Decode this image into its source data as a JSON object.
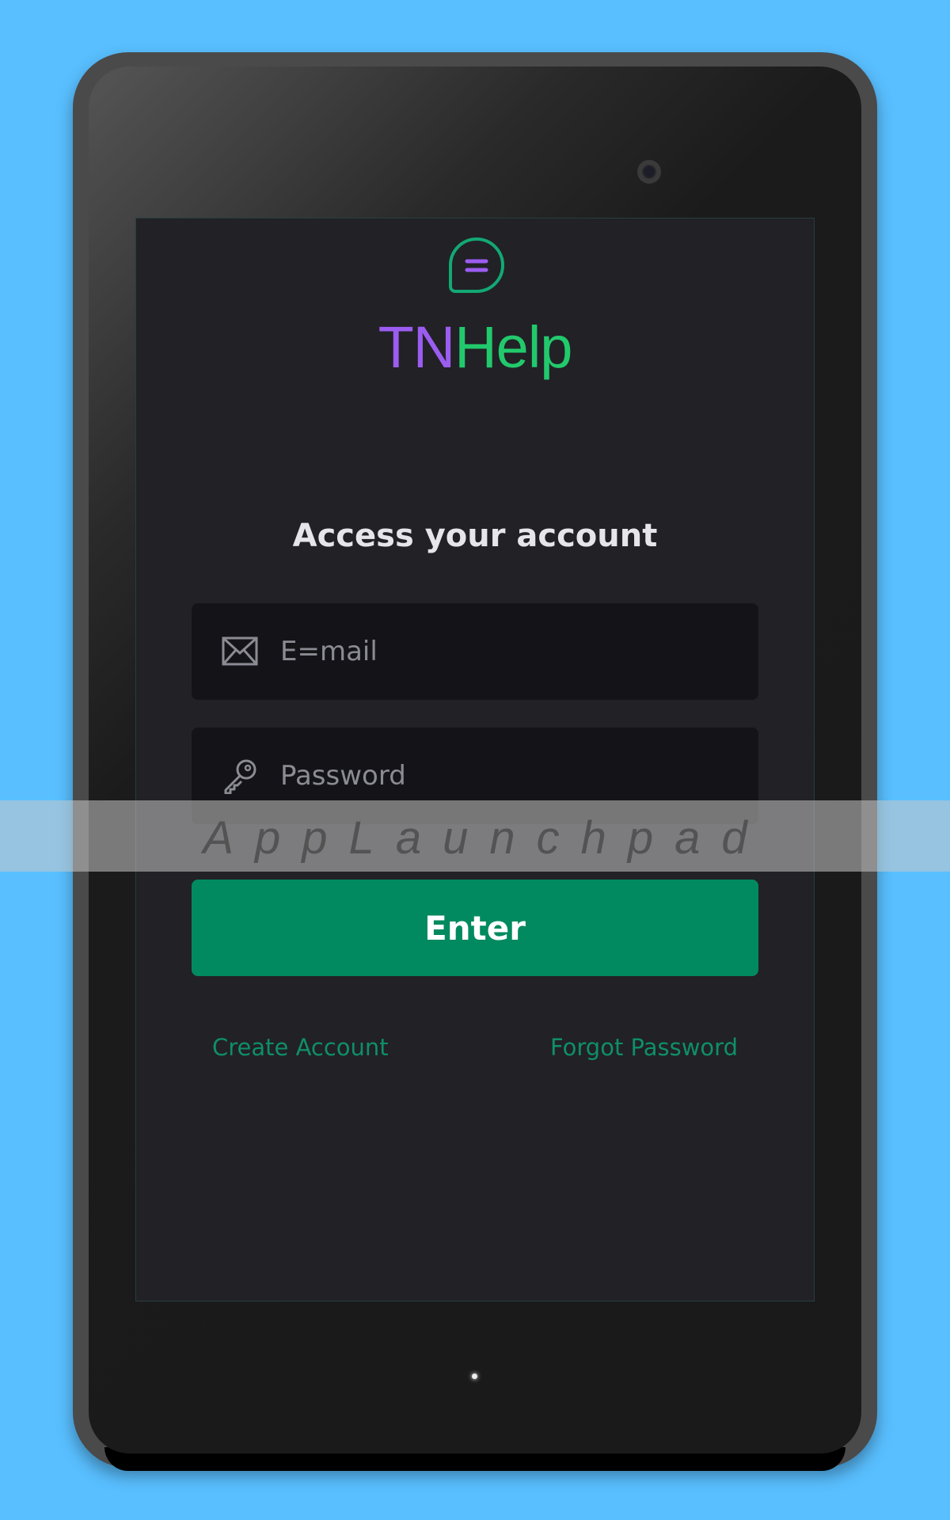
{
  "app": {
    "title_part1": "TN",
    "title_part2": "Help",
    "logo_icon": "chat-bubble-icon",
    "title_color_1": "#9b5cf0",
    "title_color_2": "#22c96c"
  },
  "login": {
    "heading": "Access your account",
    "email": {
      "placeholder": "E=mail",
      "value": "",
      "icon": "envelope-icon"
    },
    "password": {
      "placeholder": "Password",
      "value": "",
      "icon": "key-icon"
    },
    "enter_label": "Enter",
    "create_account_label": "Create Account",
    "forgot_password_label": "Forgot Password",
    "accent_color": "#018a5f"
  },
  "watermark": {
    "text": "AppLaunchpad"
  }
}
